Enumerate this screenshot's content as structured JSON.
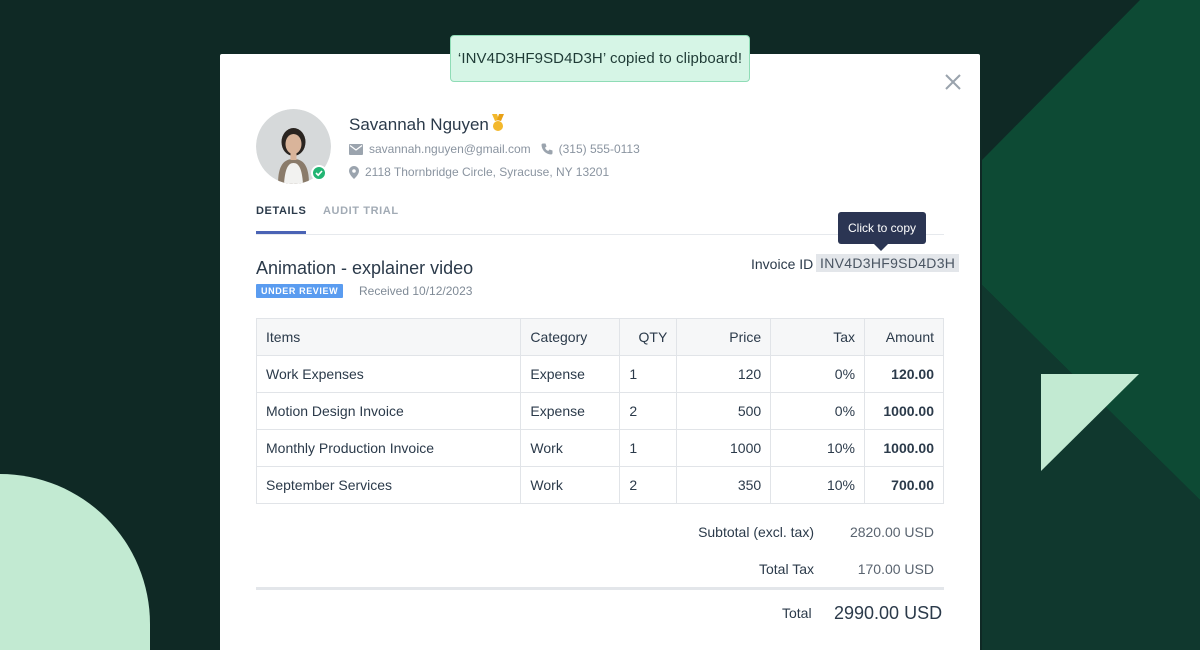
{
  "toast": {
    "message": "‘INV4D3HF9SD4D3H’ copied to clipboard!"
  },
  "profile": {
    "name": "Savannah Nguyen",
    "email": "savannah.nguyen@gmail.com",
    "phone": "(315) 555-0113",
    "address": "2118 Thornbridge Circle, Syracuse, NY 13201"
  },
  "tabs": [
    {
      "label": "DETAILS",
      "active": true
    },
    {
      "label": "AUDIT TRIAL",
      "active": false
    }
  ],
  "invoice": {
    "title": "Animation - explainer video",
    "status": "UNDER REVIEW",
    "received": "Received 10/12/2023",
    "id_label": "Invoice ID",
    "id_value": "INV4D3HF9SD4D3H",
    "tooltip": "Click to copy"
  },
  "table": {
    "headers": [
      "Items",
      "Category",
      "QTY",
      "Price",
      "Tax",
      "Amount"
    ],
    "rows": [
      [
        "Work Expenses",
        "Expense",
        "1",
        "120",
        "0%",
        "120.00"
      ],
      [
        "Motion Design Invoice",
        "Expense",
        "2",
        "500",
        "0%",
        "1000.00"
      ],
      [
        "Monthly Production Invoice",
        "Work",
        "1",
        "1000",
        "10%",
        "1000.00"
      ],
      [
        "September Services",
        "Work",
        "2",
        "350",
        "10%",
        "700.00"
      ]
    ]
  },
  "summary": {
    "subtotal_label": "Subtotal (excl. tax)",
    "subtotal_value": "2820.00 USD",
    "tax_label": "Total Tax",
    "tax_value": "170.00 USD",
    "total_label": "Total",
    "total_value": "2990.00 USD"
  },
  "colors": {
    "background": "#0f2925",
    "accent_green": "#c2ead2",
    "tab_underline": "#4a63b5",
    "status_badge": "#5a9cf0",
    "online": "#22b573"
  }
}
